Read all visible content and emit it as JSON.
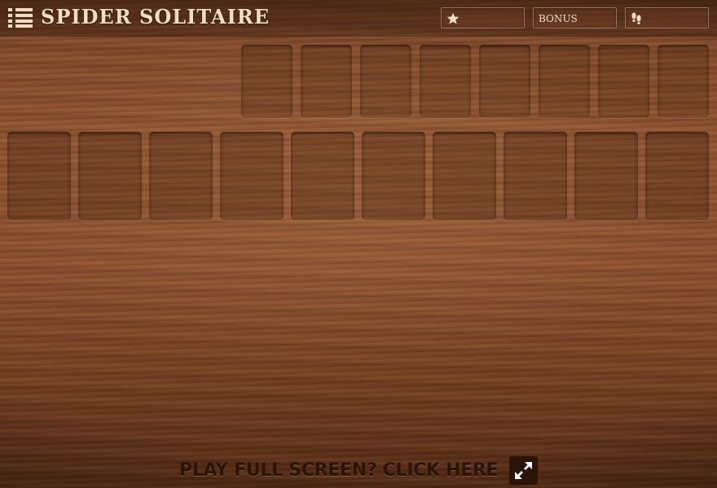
{
  "header": {
    "title": "SPIDER SOLITAIRE",
    "menu_icon": "list-menu-icon",
    "hud": {
      "score": {
        "icon": "star-icon",
        "value": ""
      },
      "bonus": {
        "label": "BONUS",
        "value": ""
      },
      "moves": {
        "icon": "footprints-icon",
        "value": ""
      }
    }
  },
  "board": {
    "foundation_slots": 8,
    "tableau_slots": 10
  },
  "footer": {
    "cta_text": "PLAY FULL SCREEN? CLICK HERE",
    "cta_icon": "fullscreen-expand-icon"
  },
  "colors": {
    "text_light": "#f0dcc3",
    "text_dark": "#2a1408",
    "wood": "#8a4f2e"
  }
}
